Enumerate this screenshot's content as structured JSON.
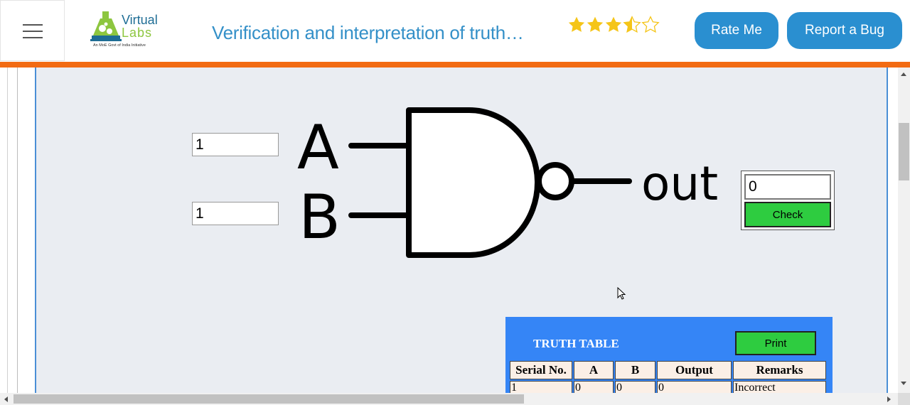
{
  "header": {
    "logo_virtual": "Virtual",
    "logo_labs": "Labs",
    "logo_tagline": "An MoE Govt of India Initiative",
    "title": "Verification and interpretation of truth…",
    "rating": 3.5,
    "rating_max": 5,
    "rate_label": "Rate Me",
    "bug_label": "Report a Bug",
    "accent_color": "#2a8fd0",
    "bar_color": "#f26b13"
  },
  "circuit": {
    "input_a_value": "1",
    "input_b_value": "1",
    "label_a": "A",
    "label_b": "B",
    "label_out": "out",
    "output_value": "0",
    "check_label": "Check",
    "gate_type": "NAND"
  },
  "truth_table": {
    "title": "TRUTH TABLE",
    "print_label": "Print",
    "columns": [
      "Serial No.",
      "A",
      "B",
      "Output",
      "Remarks"
    ],
    "rows": [
      [
        "1",
        "0",
        "0",
        "0",
        "Incorrect"
      ]
    ]
  }
}
